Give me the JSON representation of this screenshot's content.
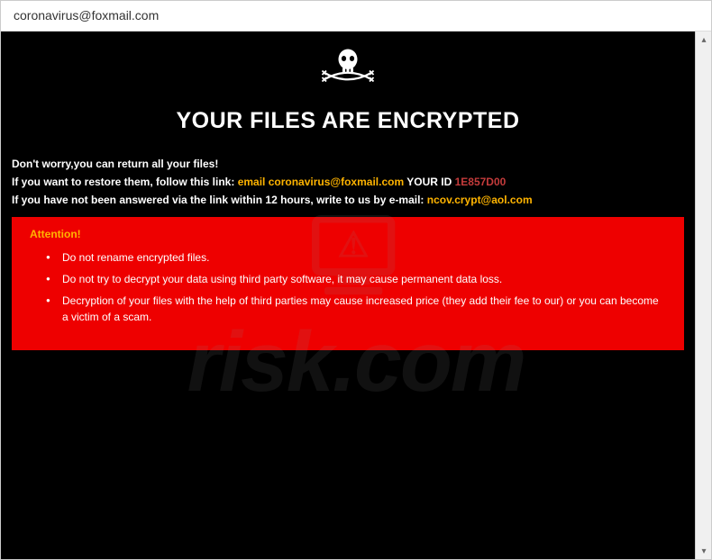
{
  "window": {
    "title": "coronavirus@foxmail.com"
  },
  "heading": "YOUR FILES ARE ENCRYPTED",
  "intro": {
    "line1": "Don't worry,you can return all your files!",
    "line2_prefix": "If you want to restore them, follow this link: ",
    "email_label": "email coronavirus@foxmail.com",
    "your_id_label": "  YOUR ID ",
    "your_id_value": "1E857D00",
    "line3_prefix": "If you have not been answered via the link within 12 hours, write to us by e-mail: ",
    "backup_email": "ncov.crypt@aol.com"
  },
  "warning": {
    "title": "Attention!",
    "items": [
      "Do not rename encrypted files.",
      "Do not try to decrypt your data using third party software, it may cause permanent data loss.",
      "Decryption of your files with the help of third parties may cause increased price (they add their fee to our) or you can become a victim of a scam."
    ]
  },
  "watermark": {
    "text": "risk.com"
  }
}
